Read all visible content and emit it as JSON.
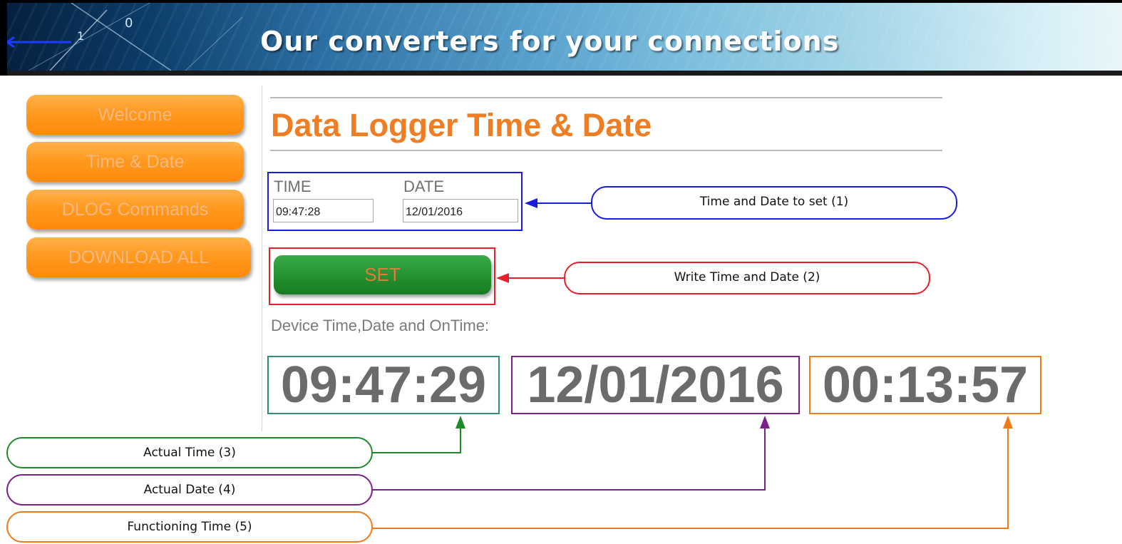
{
  "banner": {
    "title": "Our converters for your connections",
    "deco_digits": [
      "0",
      "1",
      "0"
    ]
  },
  "nav": {
    "items": [
      {
        "label": "Welcome"
      },
      {
        "label": "Time & Date"
      },
      {
        "label": "DLOG Commands"
      },
      {
        "label": "DOWNLOAD ALL"
      }
    ]
  },
  "page": {
    "title": "Data Logger Time & Date"
  },
  "form": {
    "time_label": "TIME",
    "date_label": "DATE",
    "time_value": "09:47:28",
    "date_value": "12/01/2016",
    "set_label": "SET"
  },
  "device": {
    "label": "Device Time,Date and OnTime:",
    "time": "09:47:29",
    "date": "12/01/2016",
    "on_time": "00:13:57"
  },
  "callouts": {
    "c1": "Time and Date to set (1)",
    "c2": "Write Time and Date (2)",
    "c3": "Actual Time (3)",
    "c4": "Actual Date (4)",
    "c5": "Functioning Time (5)"
  },
  "colors": {
    "accent_orange": "#ee7d23",
    "callout_blue": "#1b1bdf",
    "callout_red": "#e8202a",
    "callout_green": "#1f8a2a",
    "callout_purple": "#7a1f8c",
    "callout_orange": "#f07a18",
    "time_box": "#2f8f6f"
  }
}
